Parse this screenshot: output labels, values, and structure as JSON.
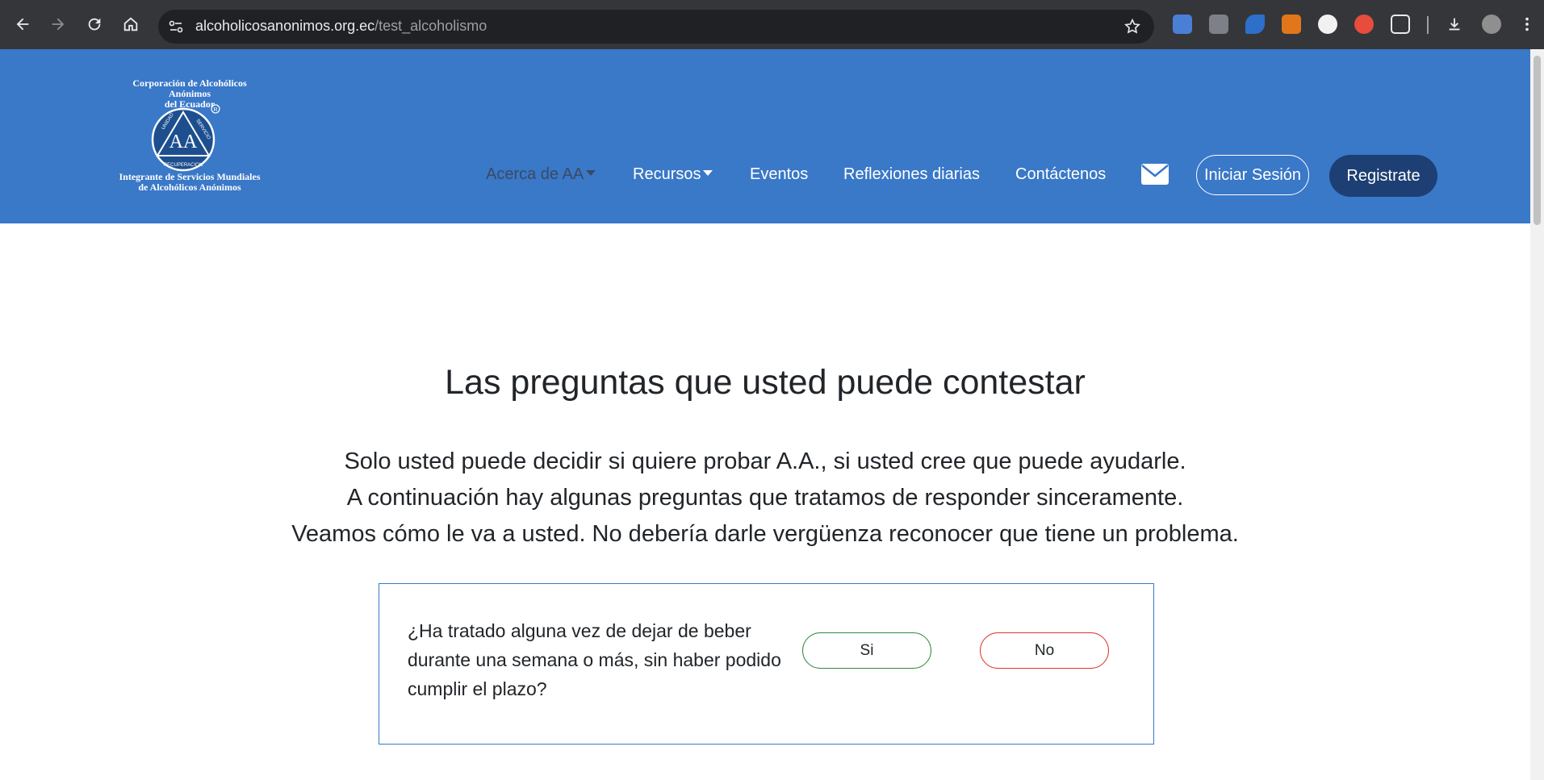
{
  "browser": {
    "url_domain": "alcoholicosanonimos.org.ec",
    "url_path": "/test_alcoholismo",
    "icons": [
      "back-icon",
      "forward-icon",
      "reload-icon",
      "home-icon",
      "site-info-icon",
      "bookmark-star-icon",
      "translate-icon",
      "extension-icon",
      "extension-icon",
      "metamask-icon",
      "extension-icon",
      "extension-icon",
      "puzzle-icon",
      "download-icon",
      "profile-avatar"
    ]
  },
  "logo": {
    "top_text_1": "Corporación de Alcohólicos Anónimos",
    "top_text_2": "del Ecuador",
    "bottom_text_1": "Integrante de Servicios Mundiales",
    "bottom_text_2": "de Alcohólicos Anónimos",
    "emblem_center": "AA",
    "emblem_words": [
      "UNIDAD",
      "SERVICIO",
      "RECUPERACION"
    ],
    "registered_mark": "R"
  },
  "nav": {
    "about": "Acerca de AA",
    "resources": "Recursos",
    "events": "Eventos",
    "reflections": "Reflexiones diarias",
    "contact": "Contáctenos",
    "login": "Iniciar Sesión",
    "register": "Registrate"
  },
  "main": {
    "title": "Las preguntas que usted puede contestar",
    "intro_1": "Solo usted puede decidir si quiere probar A.A., si usted cree que puede ayudarle.",
    "intro_2": "A continuación hay algunas preguntas que tratamos de responder sinceramente.",
    "intro_3": "Veamos cómo le va a usted. No debería darle vergüenza reconocer que tiene un problema.",
    "question": "¿Ha tratado alguna vez de dejar de beber durante una semana o más, sin haber podido cumplir el plazo?",
    "yes": "Si",
    "no": "No"
  },
  "colors": {
    "header_bg": "#3a78c8",
    "register_bg": "#1d3f73",
    "yes_border": "#2e8b3a",
    "no_border": "#dd3333",
    "chrome_bg": "#35363a"
  }
}
